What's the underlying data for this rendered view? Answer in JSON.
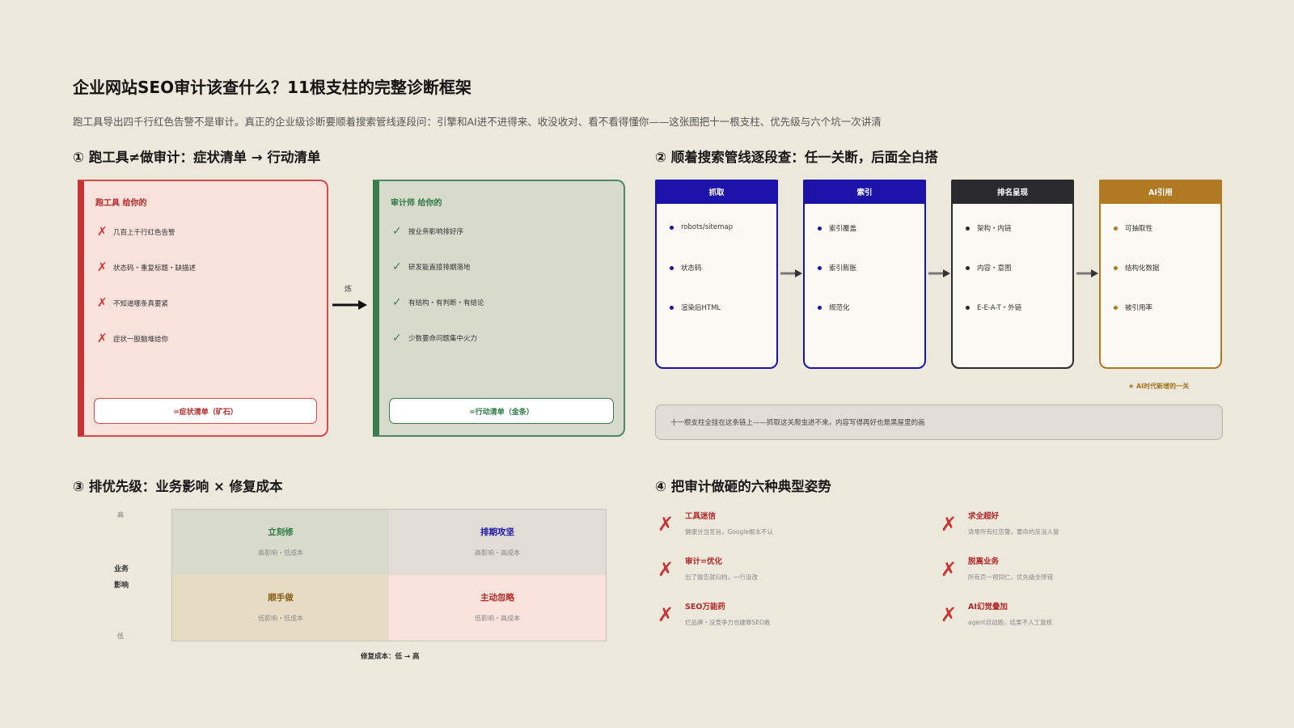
{
  "header": {
    "title": "企业网站SEO审计该查什么？11根支柱的完整诊断框架",
    "subtitle": "跑工具导出四千行红色告警不是审计。真正的企业级诊断要顺着搜索管线逐段问：引擎和AI进不进得来、收没收对、看不看得懂你——这张图把十一根支柱、优先级与六个坑一次讲清"
  },
  "section1": {
    "heading": "① 跑工具≠做审计：症状清单 → 行动清单",
    "left": {
      "header": "跑工具 给你的",
      "items": [
        "几百上千行红色告警",
        "状态码・重复标题・缺描述",
        "不知道哪条真要紧",
        "症状一股脑堆给你"
      ],
      "footer": "=症状清单（矿石）"
    },
    "arrow_label": "炼",
    "right": {
      "header": "审计师 给你的",
      "items": [
        "按业务影响排好序",
        "研发能直接排期落地",
        "有结构・有判断・有结论",
        "少数要命问题集中火力"
      ],
      "footer": "=行动清单（金条）"
    }
  },
  "section2": {
    "heading": "② 顺着搜索管线逐段查：任一关断，后面全白搭",
    "stages": [
      {
        "name": "抓取",
        "items": [
          "robots/sitemap",
          "状态码",
          "渲染后HTML"
        ],
        "color": "#1b13a8"
      },
      {
        "name": "索引",
        "items": [
          "索引覆盖",
          "索引膨胀",
          "规范化"
        ],
        "color": "#1b13a8"
      },
      {
        "name": "排名呈现",
        "items": [
          "架构・内链",
          "内容・意图",
          "E-E-A-T・外链"
        ],
        "color": "#2b2b2e"
      },
      {
        "name": "AI引用",
        "items": [
          "可抽取性",
          "结构化数据",
          "被引用率"
        ],
        "color": "#b07a22"
      }
    ],
    "ai_note": "★ AI时代新增的一关",
    "chain_note": "十一根支柱全挂在这条链上——抓取这关爬虫进不来，内容写得再好也是黑屋里的画"
  },
  "section3": {
    "heading": "③ 排优先级：业务影响 × 修复成本",
    "y_high": "高",
    "y_label_1": "业务",
    "y_label_2": "影响",
    "y_low": "低",
    "x_label": "修复成本：低 → 高",
    "cells": [
      {
        "title": "立刻修",
        "sub": "高影响・低成本",
        "color": "#2f7a45",
        "bg": "#d8dbcc"
      },
      {
        "title": "排期攻坚",
        "sub": "高影响・高成本",
        "color": "#1b13a8",
        "bg": "#e2dcd6"
      },
      {
        "title": "顺手做",
        "sub": "低影响・低成本",
        "color": "#8a5a18",
        "bg": "#e6dcc3"
      },
      {
        "title": "主动忽略",
        "sub": "低影响・高成本",
        "color": "#b52a2a",
        "bg": "#f9e1dc"
      }
    ]
  },
  "section4": {
    "heading": "④ 把审计做砸的六种典型姿势",
    "pits": [
      {
        "title": "工具迷信",
        "desc": "健康分当圣旨，Google根本不认"
      },
      {
        "title": "求全超好",
        "desc": "清零所有红告警，要命的反没人管"
      },
      {
        "title": "审计=优化",
        "desc": "出了报告就归档，一行没改"
      },
      {
        "title": "脱离业务",
        "desc": "所有页一视同仁，优先级全择错"
      },
      {
        "title": "SEO万能药",
        "desc": "烂品牌・没竞争力也硬靠SEO救"
      },
      {
        "title": "AI幻觉叠加",
        "desc": "agent自动跑，结果不人工复核"
      }
    ]
  }
}
